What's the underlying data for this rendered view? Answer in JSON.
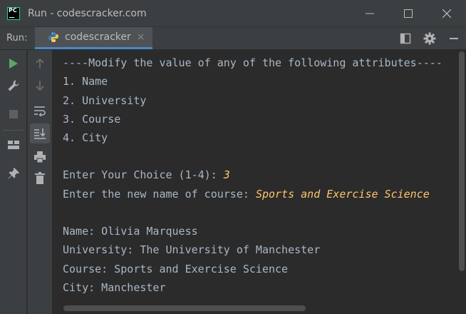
{
  "window": {
    "title": "Run - codescracker.com",
    "controls": [
      "minimize",
      "maximize",
      "close"
    ]
  },
  "run_panel": {
    "label": "Run:",
    "tab_label": "codescracker",
    "tab_close": "×",
    "header_tools": [
      "layout-icon",
      "gear-icon",
      "minimize-icon"
    ]
  },
  "left_toolbar": [
    "run-icon",
    "wrench-icon",
    "stop-icon",
    "layout-icon",
    "pin-icon"
  ],
  "console_toolbar": [
    "up-arrow-icon",
    "down-arrow-icon",
    "soft-wrap-icon",
    "scroll-to-end-icon",
    "print-icon",
    "trash-icon"
  ],
  "console": {
    "lines": [
      {
        "text": "----Modify the value of any of the following attributes----",
        "input": ""
      },
      {
        "text": "1. Name",
        "input": ""
      },
      {
        "text": "2. University",
        "input": ""
      },
      {
        "text": "3. Course",
        "input": ""
      },
      {
        "text": "4. City",
        "input": ""
      },
      {
        "text": "",
        "input": ""
      },
      {
        "text": "Enter Your Choice (1-4): ",
        "input": "3"
      },
      {
        "text": "Enter the new name of course: ",
        "input": "Sports and Exercise Science"
      },
      {
        "text": "",
        "input": ""
      },
      {
        "text": "Name: Olivia Marquess",
        "input": ""
      },
      {
        "text": "University: The University of Manchester",
        "input": ""
      },
      {
        "text": "Course: Sports and Exercise Science",
        "input": ""
      },
      {
        "text": "City: Manchester",
        "input": ""
      }
    ]
  },
  "colors": {
    "accent": "#4a88c7",
    "run_green": "#59a869",
    "input_text": "#ffc66d",
    "console_text": "#a9b7c6"
  }
}
